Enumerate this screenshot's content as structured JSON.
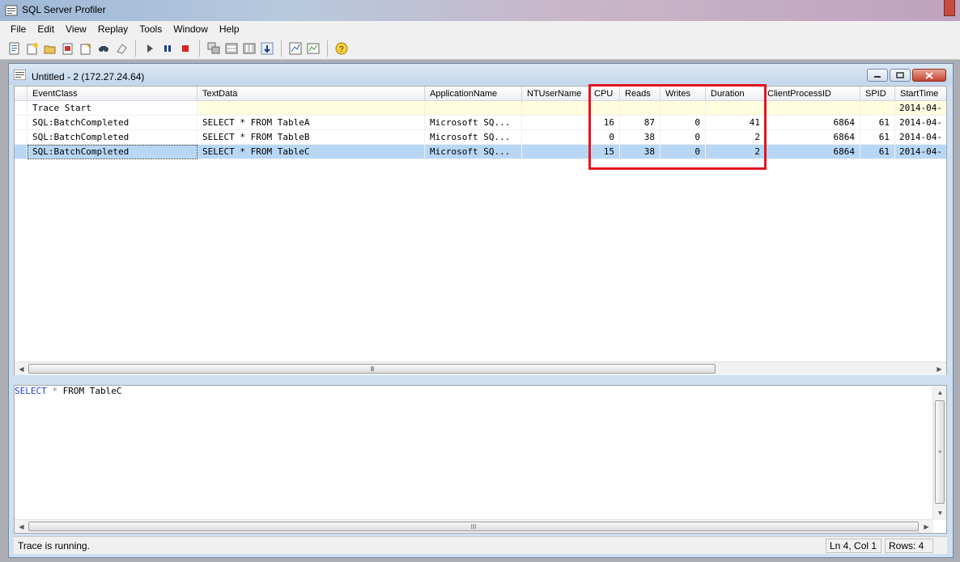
{
  "window": {
    "title": "SQL Server Profiler"
  },
  "menu": [
    "File",
    "Edit",
    "View",
    "Replay",
    "Tools",
    "Window",
    "Help"
  ],
  "toolbar": {
    "icons": [
      "new-trace-icon",
      "new-template-icon",
      "open-icon",
      "properties-icon",
      "edit-template-icon",
      "find-icon",
      "clear-icon",
      "run-icon",
      "pause-icon",
      "stop-icon",
      "cascade-icon",
      "properties-window-icon",
      "events-icon",
      "autoscroll-icon",
      "performance-icon",
      "database-tuning-icon",
      "help-icon"
    ]
  },
  "child": {
    "title": "Untitled - 2 (172.27.24.64)"
  },
  "grid": {
    "columns": [
      "EventClass",
      "TextData",
      "ApplicationName",
      "NTUserName",
      "CPU",
      "Reads",
      "Writes",
      "Duration",
      "ClientProcessID",
      "SPID",
      "StartTime"
    ],
    "rows": [
      [
        "Trace Start",
        "",
        "",
        "",
        "",
        "",
        "",
        "",
        "",
        "",
        "2014-04-"
      ],
      [
        "SQL:BatchCompleted",
        "SELECT * FROM TableA",
        "Microsoft SQ...",
        "",
        "16",
        "87",
        "0",
        "41",
        "6864",
        "61",
        "2014-04-"
      ],
      [
        "SQL:BatchCompleted",
        "SELECT * FROM TableB",
        "Microsoft SQ...",
        "",
        "0",
        "38",
        "0",
        "2",
        "6864",
        "61",
        "2014-04-"
      ],
      [
        "SQL:BatchCompleted",
        "SELECT * FROM TableC",
        "Microsoft SQ...",
        "",
        "15",
        "38",
        "0",
        "2",
        "6864",
        "61",
        "2014-04-"
      ]
    ],
    "selected_row": 3
  },
  "text_pane": {
    "keyword": "SELECT",
    "operator": "*",
    "rest": "FROM TableC"
  },
  "status": {
    "message": "Trace is running.",
    "position": "Ln 4, Col 1",
    "rows": "Rows: 4"
  },
  "colors": {
    "highlight_box": "#e3151f",
    "selected_row": "#b8d7f5",
    "trace_start_row": "#fffde0",
    "keyword": "#1f3fd1"
  }
}
